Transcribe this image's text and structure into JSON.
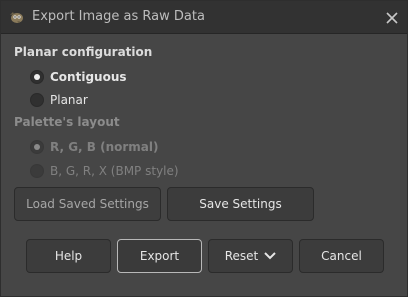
{
  "window": {
    "title": "Export Image as Raw Data",
    "app_icon": "gimp-icon",
    "close_icon": "close-icon"
  },
  "planar": {
    "heading": "Planar configuration",
    "options": [
      {
        "label": "Contiguous",
        "checked": true
      },
      {
        "label": "Planar",
        "checked": false
      }
    ]
  },
  "palette": {
    "heading": "Palette's layout",
    "options": [
      {
        "label": "R, G, B (normal)",
        "checked": true,
        "disabled": true
      },
      {
        "label": "B, G, R, X (BMP style)",
        "checked": false,
        "disabled": true
      }
    ]
  },
  "settings": {
    "load_label": "Load Saved Settings",
    "save_label": "Save Settings"
  },
  "actions": {
    "help_label": "Help",
    "export_label": "Export",
    "reset_label": "Reset",
    "cancel_label": "Cancel"
  }
}
